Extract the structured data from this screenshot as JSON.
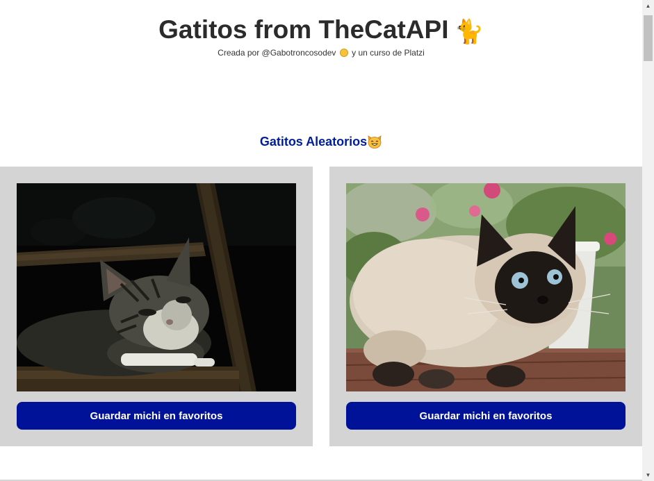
{
  "header": {
    "title": "Gatitos from TheCatAPI",
    "title_emoji": "🐈",
    "subtitle_before": "Creada por @Gabotroncosodev",
    "subtitle_after": "y un curso de Platzi"
  },
  "section": {
    "title": "Gatitos Aleatorios",
    "icon": "smiling-cat-face-icon"
  },
  "cards": [
    {
      "image_alt": "tabby cat in wooden frame",
      "button_label": "Guardar michi en favoritos"
    },
    {
      "image_alt": "siamese cat on table",
      "button_label": "Guardar michi en favoritos"
    }
  ],
  "colors": {
    "accent": "#001298",
    "section_title": "#001d9a",
    "card_bg": "#d4d4d4"
  }
}
